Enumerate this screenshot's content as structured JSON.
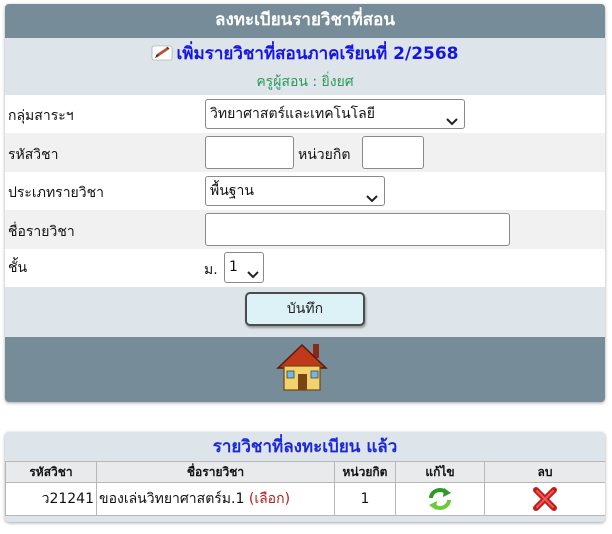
{
  "register_panel": {
    "header": "ลงทะเบียนรายวิชาที่สอน",
    "subtitle": "เพิ่มรายวิชาที่สอนภาคเรียนที่ 2/2568",
    "teacher": "ครูผู้สอน : ยิ่งยศ"
  },
  "form": {
    "group_label": "กลุ่มสาระฯ",
    "group_value": "วิทยาศาสตร์และเทคโนโลยี",
    "code_label": "รหัสวิชา",
    "code_value": "",
    "credit_label": "หน่วยกิต",
    "credit_value": "",
    "type_label": "ประเภทรายวิชา",
    "type_value": "พื้นฐาน",
    "name_label": "ชื่อรายวิชา",
    "name_value": "",
    "level_label": "ชั้น",
    "level_prefix": "ม.",
    "level_value": "1",
    "save_label": "บันทึก"
  },
  "icons": {
    "edit_pencil": "pencil-icon",
    "home": "house-icon",
    "edit_row": "refresh-arrows-icon",
    "delete_row": "red-x-icon"
  },
  "colors": {
    "header_bg": "#778c99",
    "panel_bg": "#dde5ea",
    "subtitle": "#1616e0",
    "teacher": "#2a9a57",
    "pick": "#bb1a1a"
  },
  "registered": {
    "title": "รายวิชาที่ลงทะเบียน แล้ว",
    "columns": [
      "รหัสวิชา",
      "ชื่อรายวิชา",
      "หน่วยกิต",
      "แก้ไข",
      "ลบ"
    ],
    "rows": [
      {
        "code": "ว21241",
        "name": "ของเล่นวิทยาศาสตร์ม.1",
        "pick_label": "(เลือก)",
        "credit": "1"
      }
    ]
  }
}
